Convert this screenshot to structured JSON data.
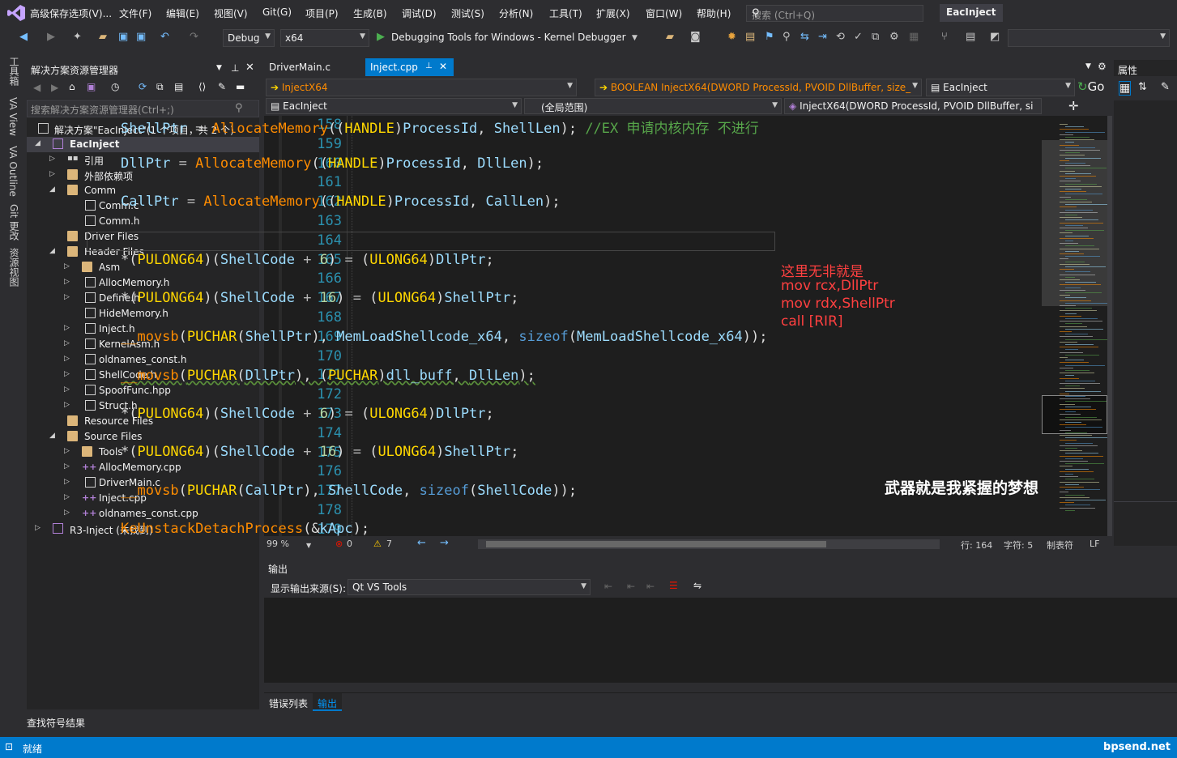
{
  "app": {
    "solution_title": "EacInject"
  },
  "menu": {
    "items": [
      "高级保存选项(V)...",
      "文件(F)",
      "编辑(E)",
      "视图(V)",
      "Git(G)",
      "项目(P)",
      "生成(B)",
      "调试(D)",
      "测试(S)",
      "分析(N)",
      "工具(T)",
      "扩展(X)",
      "窗口(W)",
      "帮助(H)"
    ]
  },
  "search": {
    "placeholder": "搜索 (Ctrl+Q)"
  },
  "toolbar": {
    "config": "Debug",
    "platform": "x64",
    "debugger": "Debugging Tools for Windows - Kernel Debugger"
  },
  "left_rail": {
    "tabs": [
      "工具箱",
      "VA View",
      "VA Outline",
      "Git 更改",
      "资源视图"
    ]
  },
  "solution_explorer": {
    "title": "解决方案资源管理器",
    "search_placeholder": "搜索解决方案资源管理器(Ctrl+;)",
    "root": "解决方案\"EacInject\"(1 个项目，共 2 个)",
    "items": [
      {
        "label": "EacInject"
      },
      {
        "label": "引用"
      },
      {
        "label": "外部依赖项"
      },
      {
        "label": "Comm"
      },
      {
        "label": "Comm.c"
      },
      {
        "label": "Comm.h"
      },
      {
        "label": "Driver Files"
      },
      {
        "label": "Header Files"
      },
      {
        "label": "Asm"
      },
      {
        "label": "AllocMemory.h"
      },
      {
        "label": "Define.h"
      },
      {
        "label": "HideMemory.h"
      },
      {
        "label": "Inject.h"
      },
      {
        "label": "KernelAsm.h"
      },
      {
        "label": "oldnames_const.h"
      },
      {
        "label": "ShellCode.h"
      },
      {
        "label": "SpoofFunc.hpp"
      },
      {
        "label": "Struct.h"
      },
      {
        "label": "Resource Files"
      },
      {
        "label": "Source Files"
      },
      {
        "label": "Tools"
      },
      {
        "label": "AllocMemory.cpp"
      },
      {
        "label": "DriverMain.c"
      },
      {
        "label": "Inject.cpp"
      },
      {
        "label": "oldnames_const.cpp"
      },
      {
        "label": "R3-Inject (未找到)"
      }
    ],
    "find_results": "查找符号结果"
  },
  "editor": {
    "tabs": [
      "DriverMain.c",
      "Inject.cpp"
    ],
    "nav_scope": "InjectX64",
    "nav_function": "BOOLEAN InjectX64(DWORD ProcessId, PVOID DllBuffer, size_",
    "nav_project": "EacInject",
    "nav_go": "Go",
    "nav2_project": "EacInject",
    "nav2_scope": "(全局范围)",
    "nav2_member": "InjectX64(DWORD ProcessId, PVOID DllBuffer, si",
    "line_numbers": [
      "158",
      "159",
      "160",
      "161",
      "162",
      "163",
      "164",
      "165",
      "166",
      "167",
      "168",
      "169",
      "170",
      "171",
      "172",
      "173",
      "174",
      "175",
      "176",
      "177",
      "178",
      "179"
    ],
    "annotations": [
      "这里无非就是",
      "mov rcx,DllPtr",
      "mov rdx,ShellPtr",
      "call [RIR]"
    ],
    "overlay_text": "武器就是我紧握的梦想"
  },
  "editor_status": {
    "zoom": "99 %",
    "errors": "0",
    "warnings": "7",
    "line": "行: 164",
    "char": "字符: 5",
    "tabs": "制表符",
    "eol": "LF"
  },
  "properties": {
    "title": "属性"
  },
  "output": {
    "title": "输出",
    "source_label": "显示输出来源(S):",
    "source_value": "Qt VS Tools"
  },
  "bottom_tabs": [
    "错误列表",
    "输出"
  ],
  "status": {
    "ready": "就绪",
    "brand": "bpsend.net"
  },
  "colors": {
    "accent": "#007acc",
    "annotation": "#ff4040"
  }
}
